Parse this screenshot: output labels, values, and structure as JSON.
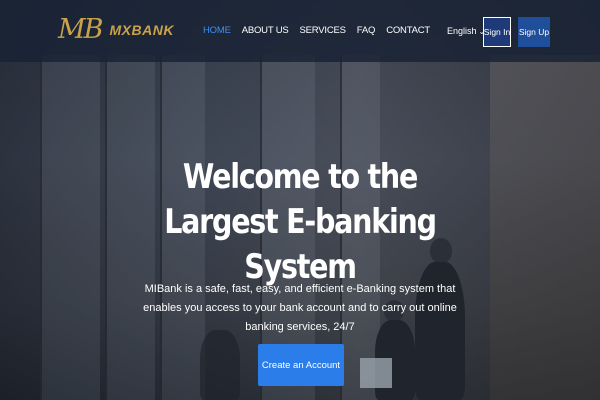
{
  "brand": {
    "mark": "MB",
    "name": "MXBANK",
    "color": "#c9a24a"
  },
  "nav": {
    "links": [
      {
        "label": "HOME",
        "active": true
      },
      {
        "label": "ABOUT US",
        "active": false
      },
      {
        "label": "SERVICES",
        "active": false
      },
      {
        "label": "FAQ",
        "active": false
      },
      {
        "label": "CONTACT",
        "active": false
      }
    ],
    "language": "English",
    "language_icon": "chevron-down-icon",
    "signin_label": "Sign In",
    "signup_label": "Sign Up"
  },
  "hero": {
    "title": "Welcome to the Largest E-banking System",
    "description": "MIBank is a safe, fast, easy, and efficient e-Banking system that enables you access to your bank account and to carry out online banking services, 24/7",
    "cta_label": "Create an Account"
  },
  "colors": {
    "accent": "#2b7de9",
    "nav_active": "#3f8ff0",
    "navbar_bg": "#182234"
  }
}
